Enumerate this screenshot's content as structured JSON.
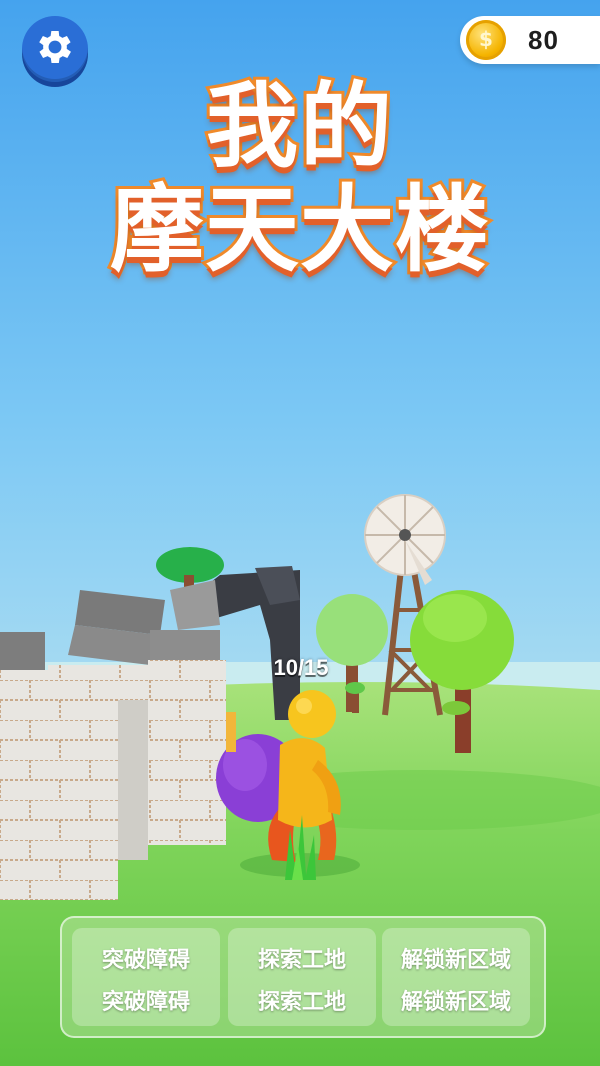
{
  "header": {
    "settings_icon": "gear-icon",
    "coin_icon": "dollar-coin-icon",
    "coin_symbol": "$",
    "coin_count": "80"
  },
  "title": {
    "line1": "我的",
    "line2": "摩天大楼"
  },
  "hud": {
    "carry_progress": "10/15"
  },
  "tags": {
    "col1": [
      "突破障碍",
      "突破障碍"
    ],
    "col2": [
      "探索工地",
      "探索工地"
    ],
    "col3": [
      "解锁新区域",
      "解锁新区域"
    ]
  },
  "colors": {
    "sky_top": "#4aa6ee",
    "ground": "#7bd45a",
    "title_stroke": "#f08a2a",
    "settings_blue": "#2a6ed6",
    "coin_gold": "#f5b400",
    "character_yellow": "#f7c51e",
    "backpack_purple": "#8a3fd6"
  }
}
